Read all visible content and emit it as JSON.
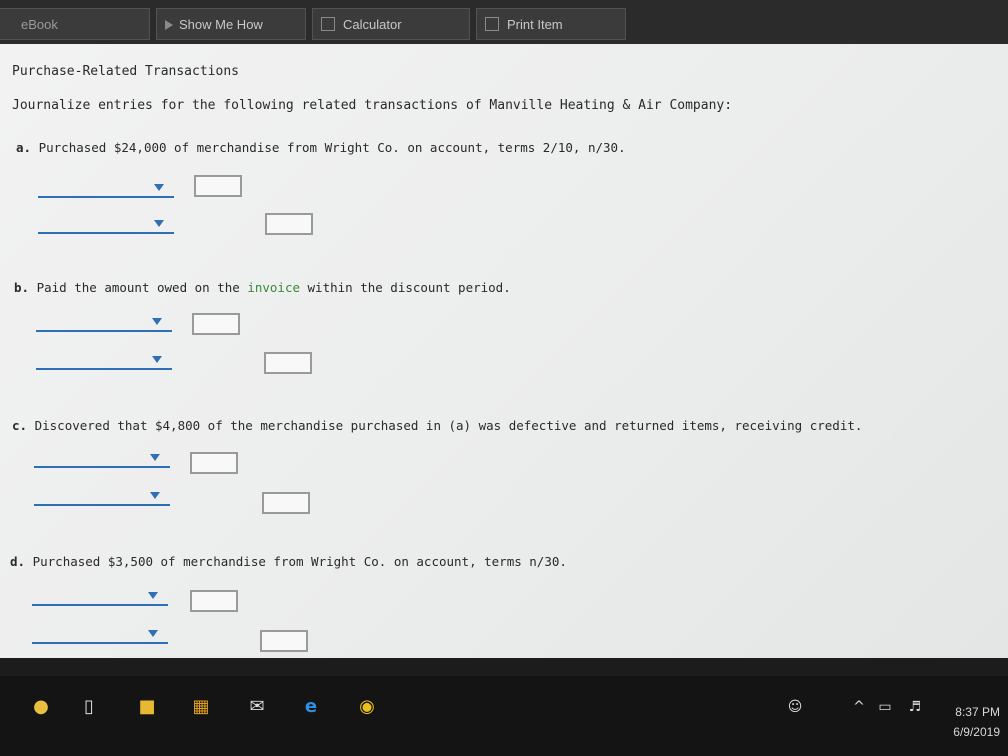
{
  "toolbar": {
    "ebook": "eBook",
    "show_me_how": "Show Me How",
    "calculator": "Calculator",
    "print_item": "Print Item"
  },
  "page": {
    "title": "Purchase-Related Transactions",
    "instructions": "Journalize entries for the following related transactions of Manville Heating & Air Company:"
  },
  "questions": [
    {
      "letter": "a.",
      "text": "Purchased $24,000 of merchandise from Wright Co. on account, terms 2/10, n/30."
    },
    {
      "letter": "b.",
      "pre": "Paid the amount owed on the ",
      "link": "invoice",
      "post": " within the discount period."
    },
    {
      "letter": "c.",
      "text": "Discovered that $4,800 of the merchandise purchased in (a) was defective and returned items, receiving credit."
    },
    {
      "letter": "d.",
      "text": "Purchased $3,500 of merchandise from Wright Co. on account, terms n/30."
    }
  ],
  "clock": {
    "time": "8:37 PM",
    "date": "6/9/2019"
  },
  "colors": {
    "accent": "#2f6fb5",
    "link": "#3a8a3a"
  },
  "icons": [
    "microphone-icon",
    "task-view-icon",
    "file-explorer-icon",
    "store-icon",
    "mail-icon",
    "edge-icon",
    "chrome-icon",
    "people-icon",
    "chevron-up-icon",
    "battery-icon",
    "volume-icon"
  ]
}
